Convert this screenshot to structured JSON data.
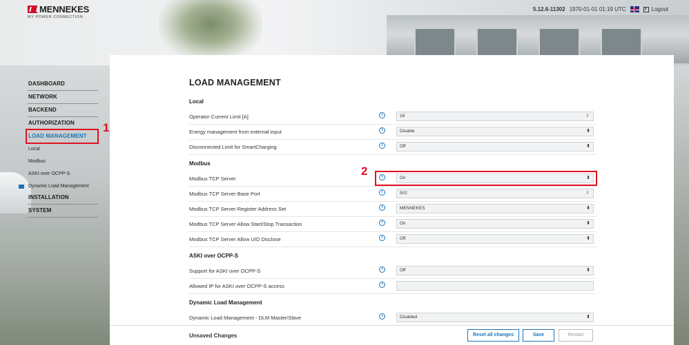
{
  "header": {
    "brand": "MENNEKES",
    "tagline": "MY POWER CONNECTION",
    "version": "5.12.6-11302",
    "datetime": "1970-01-01 01:19 UTC",
    "logout": "Logout"
  },
  "sidebar": {
    "items": [
      "DASHBOARD",
      "NETWORK",
      "BACKEND",
      "AUTHORIZATION",
      "LOAD MANAGEMENT"
    ],
    "subitems": [
      "Local",
      "Modbus",
      "ASKI over OCPP-S",
      "Dynamic Load Management"
    ],
    "items_after": [
      "INSTALLATION",
      "SYSTEM"
    ]
  },
  "annotations": {
    "one": "1",
    "two": "2"
  },
  "main": {
    "title": "LOAD MANAGEMENT",
    "sections": {
      "local": {
        "title": "Local",
        "rows": [
          {
            "label": "Operator Current Limit [A]",
            "value": "16"
          },
          {
            "label": "Energy management from external input",
            "value": "Disable"
          },
          {
            "label": "Disconnected Limit for SmartCharging",
            "value": "Off"
          }
        ]
      },
      "modbus": {
        "title": "Modbus",
        "rows": [
          {
            "label": "Modbus TCP Server",
            "value": "On"
          },
          {
            "label": "Modbus TCP Server Base Port",
            "value": "502"
          },
          {
            "label": "Modbus TCP Server Register Address Set",
            "value": "MENNEKES"
          },
          {
            "label": "Modbus TCP Server Allow Start/Stop Transaction",
            "value": "On"
          },
          {
            "label": "Modbus TCP Server Allow UID Disclose",
            "value": "Off"
          }
        ]
      },
      "aski": {
        "title": "ASKI over OCPP-S",
        "rows": [
          {
            "label": "Support for ASKI over OCPP-S",
            "value": "Off"
          },
          {
            "label": "Allowed IP for ASKI over OCPP-S access",
            "value": ""
          }
        ]
      },
      "dlm": {
        "title": "Dynamic Load Management",
        "rows": [
          {
            "label": "Dynamic Load Management - DLM Master/Slave",
            "value": "Disabled"
          }
        ]
      }
    },
    "info_glyph": "i"
  },
  "footer": {
    "label": "Unsaved Changes",
    "reset": "Reset all changes",
    "save": "Save",
    "restart": "Restart"
  },
  "colors": {
    "accent": "#1a73b8",
    "annotation": "#e0101e",
    "brand_red": "#d0102a"
  }
}
